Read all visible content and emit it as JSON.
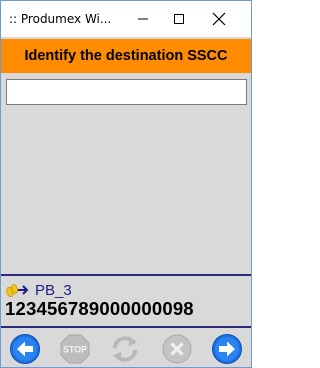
{
  "window": {
    "title": ":: Produmex Wi..."
  },
  "header": {
    "title": "Identify the destination SSCC"
  },
  "input": {
    "value": "",
    "placeholder": ""
  },
  "status": {
    "location_label": "PB_3",
    "sscc": "123456789000000098"
  },
  "toolbar": {
    "back_icon": "arrow-left-icon",
    "stop_label": "STOP",
    "refresh_icon": "refresh-icon",
    "cancel_icon": "cancel-icon",
    "next_icon": "arrow-right-icon"
  },
  "colors": {
    "header_bg": "#ff8c00",
    "accent_blue": "#1e6fe0",
    "separator": "#2b2b7a",
    "body_bg": "#d9d9d9"
  }
}
